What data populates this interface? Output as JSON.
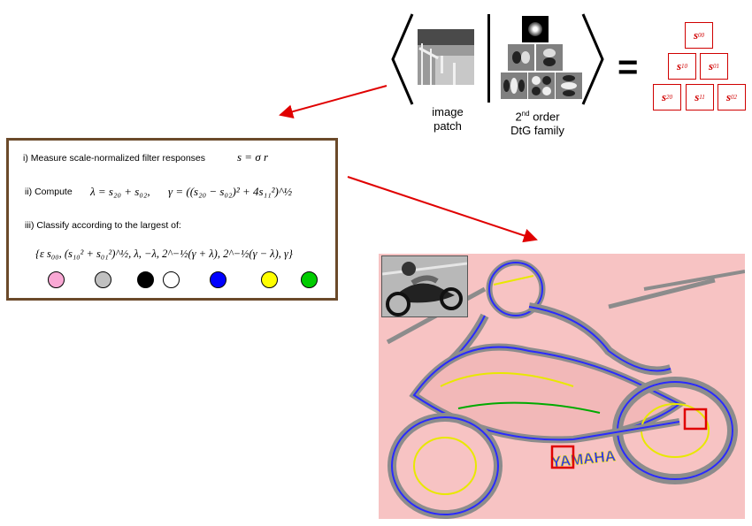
{
  "patch_caption": "image\npatch",
  "family_caption_prefix": "2",
  "family_caption_sup": "nd",
  "family_caption_rest": " order",
  "family_caption_line2": "DtG family",
  "equals": "=",
  "responses": {
    "s00": {
      "base": "s",
      "sub": "00"
    },
    "s10": {
      "base": "s",
      "sub": "10"
    },
    "s01": {
      "base": "s",
      "sub": "01"
    },
    "s20": {
      "base": "s",
      "sub": "20"
    },
    "s11": {
      "base": "s",
      "sub": "11"
    },
    "s02": {
      "base": "s",
      "sub": "02"
    }
  },
  "steps": {
    "measure": "i) Measure scale-normalized filter responses",
    "measure_eq": "s = σ r",
    "compute": "ii) Compute",
    "compute_eq1": "λ = s₂₀ + s₀₂,",
    "compute_eq2": "γ = ((s₂₀ − s₀₂)² + 4s₁₁²)^½",
    "classify": "iii) Classify according to the largest of:",
    "classify_eq": "{ε s₀₀,  (s₁₀² + s₀₁²)^½,  λ,  −λ,  2^−½(γ + λ),  2^−½(γ − λ),  γ}"
  },
  "class_colors": [
    "#f9a8d4",
    "#c0c0c0",
    "#000000",
    "#ffffff",
    "#0000ff",
    "#ffff00",
    "#00cc00"
  ],
  "bike_label": "YAMAHA",
  "colors": {
    "arrow": "#e00000",
    "panel_border": "#6b4a2a",
    "highlight_box": "#e00000",
    "background_class": "#f7c3c3",
    "edge_gray": "#8c8c8c",
    "edge_blue": "#2a2aff",
    "edge_yellow": "#e8e800",
    "edge_green": "#00aa00"
  }
}
